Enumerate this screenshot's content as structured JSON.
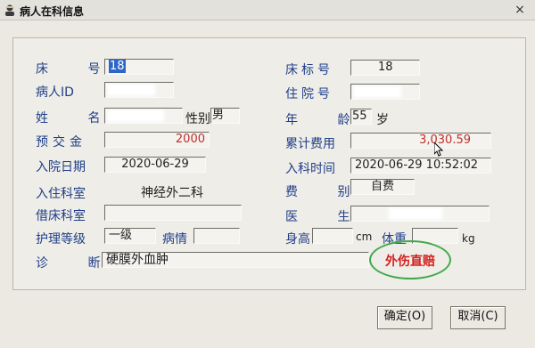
{
  "window": {
    "title": "病人在科信息",
    "close_glyph": "×"
  },
  "labels": {
    "bed_no": "床  号",
    "patient_id": "病人ID",
    "name": "姓  名",
    "prepaid": "预交金",
    "admit_date": "入院日期",
    "admit_dept": "入住科室",
    "borrow_dept": "借床科室",
    "nursing_level": "护理等级",
    "diagnosis": "诊  断",
    "bed_label": "床标号",
    "inpatient_no": "住院号",
    "age": "年  龄",
    "total_cost": "累计费用",
    "dept_time": "入科时间",
    "fee_type": "费  别",
    "doctor": "医  生",
    "height": "身高",
    "weight": "体重",
    "gender": "性别",
    "condition": "病情",
    "age_unit": "岁",
    "height_unit": "cm",
    "weight_unit": "kg"
  },
  "values": {
    "bed_no": "18",
    "bed_label": "18",
    "patient_id": "",
    "inpatient_no": "",
    "name": "",
    "gender": "男",
    "age": "55",
    "prepaid": "2000",
    "total_cost": "3,030.59",
    "admit_date": "2020-06-29",
    "dept_time": "2020-06-29 10:52:02",
    "admit_dept": "神经外二科",
    "fee_type": "自费",
    "borrow_dept": "",
    "doctor": "",
    "nursing_level": "一级",
    "condition": "",
    "height": "",
    "weight": "",
    "diagnosis": "硬膜外血肿"
  },
  "stamp": {
    "text": "外伤直赔",
    "color": "#d41e1e",
    "ring_color": "#3faa4c"
  },
  "buttons": {
    "ok": "确定(O)",
    "cancel": "取消(C)"
  },
  "colors": {
    "label": "#1f3f8a",
    "money": "#c0302a",
    "selection": "#2e66c8"
  }
}
